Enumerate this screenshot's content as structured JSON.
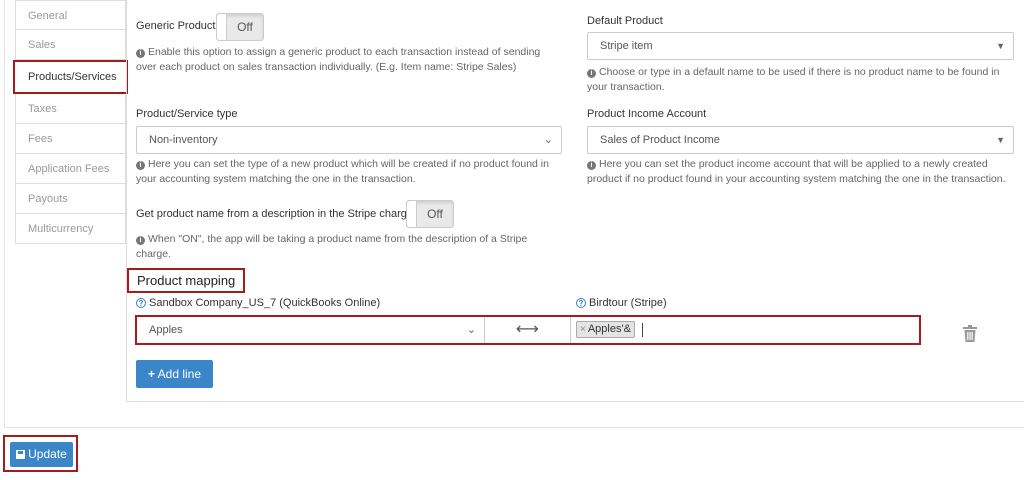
{
  "sidebar": {
    "items": [
      {
        "label": "General"
      },
      {
        "label": "Sales"
      },
      {
        "label": "Products/Services"
      },
      {
        "label": "Taxes"
      },
      {
        "label": "Fees"
      },
      {
        "label": "Application Fees"
      },
      {
        "label": "Payouts"
      },
      {
        "label": "Multicurrency"
      }
    ],
    "active_index": 2
  },
  "generic_product": {
    "label": "Generic Product",
    "toggle": "Off",
    "help_line1": "Enable this option to assign a generic product to each transaction instead of sending",
    "help_line2": "over each product on sales transaction individually. (E.g. Item name: Stripe Sales)"
  },
  "default_product": {
    "label": "Default Product",
    "value": "Stripe item",
    "help_line1": "Choose or type in a default name to be used if there is no product name to be found in",
    "help_line2": "your transaction."
  },
  "product_type": {
    "label": "Product/Service type",
    "value": "Non-inventory",
    "help_line1": "Here you can set the type of a new product which will be created if no product found in",
    "help_line2": "your accounting system matching the one in the transaction."
  },
  "income_account": {
    "label": "Product Income Account",
    "value": "Sales of Product Income",
    "help_line1": "Here you can set the product income account that will be applied to a newly created",
    "help_line2": "product if no product found in your accounting system matching the one in the transaction."
  },
  "name_from_description": {
    "label": "Get product name from a description in the Stripe charge",
    "toggle": "Off",
    "help_line1": "When \"ON\", the app will be taking a product name from the description of a Stripe",
    "help_line2": "charge."
  },
  "mapping": {
    "title": "Product mapping",
    "left_header": "Sandbox Company_US_7 (QuickBooks Online)",
    "right_header": "Birdtour (Stripe)",
    "row": {
      "left_value": "Apples",
      "arrow": "⟷",
      "tag": "Apples'&"
    },
    "add_line": "Add line"
  },
  "footer": {
    "update": "Update"
  },
  "colors": {
    "highlight": "#a51b1b",
    "primary": "#3a86c8"
  }
}
